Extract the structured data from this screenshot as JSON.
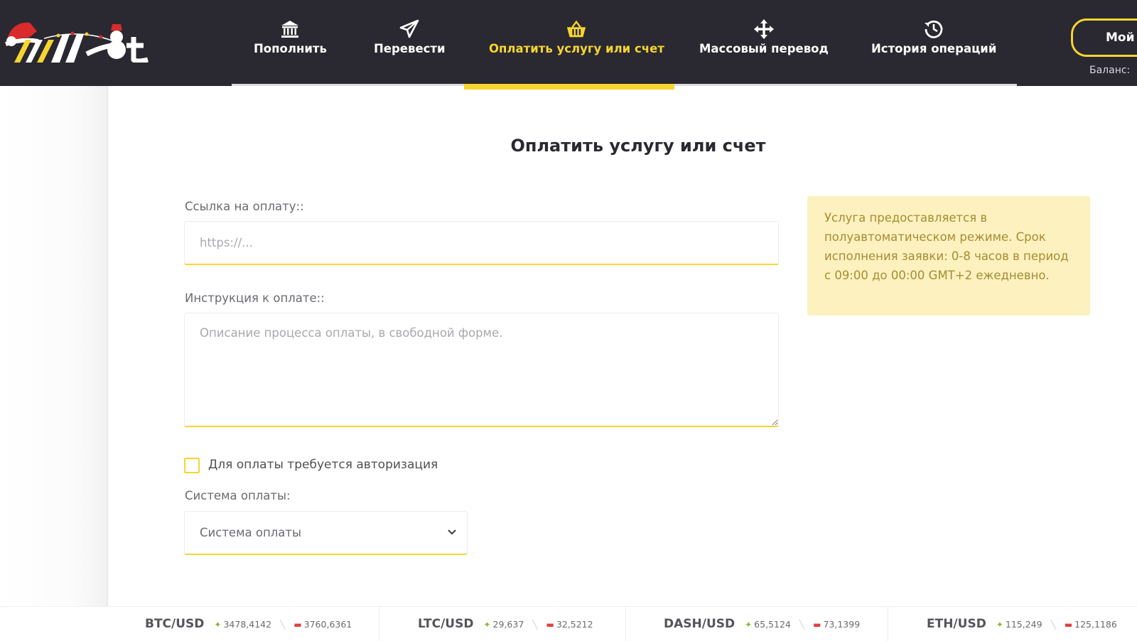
{
  "header": {
    "logo_text": "Wallet",
    "nav": [
      {
        "label": "Пополнить",
        "icon": "bank-icon",
        "active": false
      },
      {
        "label": "Перевести",
        "icon": "paper-plane-icon",
        "active": false
      },
      {
        "label": "Оплатить услугу или счет",
        "icon": "basket-icon",
        "active": true
      },
      {
        "label": "Массовый перевод",
        "icon": "arrows-move-icon",
        "active": false
      },
      {
        "label": "История операций",
        "icon": "history-icon",
        "active": false
      }
    ],
    "account_button": "Мой",
    "balance_label": "Баланс:"
  },
  "main": {
    "title": "Оплатить услугу или счет",
    "link_label": "Ссылка на оплату::",
    "link_placeholder": "https://...",
    "instruction_label": "Инструкция к оплате::",
    "instruction_placeholder": "Описание процесса оплаты, в свободной форме.",
    "auth_checkbox_label": "Для оплаты требуется авторизация",
    "auth_checked": false,
    "system_label": "Система оплаты:",
    "system_selected": "Система оплаты",
    "info_text": "Услуга предоставляется в полуавтоматическом режиме. Срок исполнения заявки: 0-8 часов в период с 09:00 до 00:00 GMT+2 ежедневно."
  },
  "ticker": [
    {
      "pair": "BTC/USD",
      "buy": "3478,4142",
      "sell": "3760,6361"
    },
    {
      "pair": "LTC/USD",
      "buy": "29,637",
      "sell": "32,5212"
    },
    {
      "pair": "DASH/USD",
      "buy": "65,5124",
      "sell": "73,1399"
    },
    {
      "pair": "ETH/USD",
      "buy": "115,249",
      "sell": "125,1186"
    }
  ],
  "colors": {
    "header_bg": "#2a2830",
    "accent": "#f5d530",
    "info_bg": "#fdf1bf",
    "info_text": "#a48d32",
    "up": "#8db43a",
    "down": "#e04040"
  }
}
